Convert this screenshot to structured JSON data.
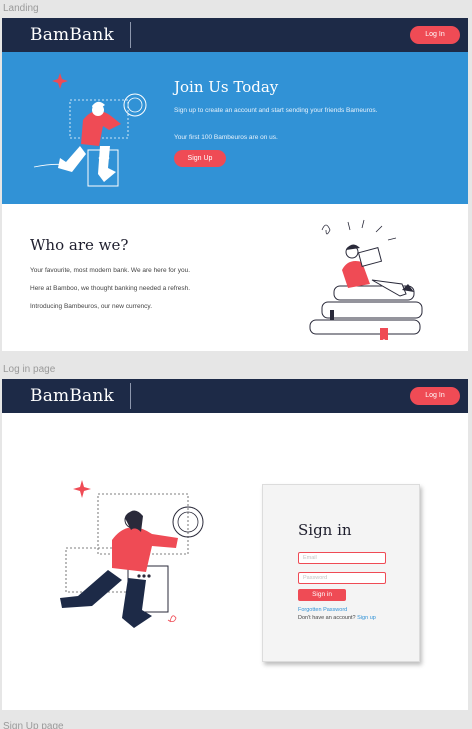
{
  "sections": {
    "landing_label": "Landing",
    "login_label": "Log in page",
    "signup_label": "Sign Up page"
  },
  "brand": "BamBank",
  "nav": {
    "login_label": "Log In"
  },
  "hero": {
    "title": "Join Us Today",
    "subtitle": "Sign up to create an account and start sending your friends Bameuros.",
    "note": "Your first 100 Bambeuros are on us.",
    "signup_label": "Sign Up"
  },
  "about": {
    "title": "Who are we?",
    "p1": "Your favourite, most modern bank. We are here for you.",
    "p2": "Here at Bamboo, we thought banking needed a refresh.",
    "p3": "Introducing Bambeuros, our new currency."
  },
  "signin": {
    "title": "Sign in",
    "email_placeholder": "Email",
    "password_placeholder": "Password",
    "button_label": "Sign in",
    "forgot_label": "Forgotten Password",
    "no_account_text": "Don't have an account?",
    "signup_link": "Sign up"
  },
  "colors": {
    "navy": "#1d2a47",
    "blue": "#3192d6",
    "coral": "#ef4b55"
  }
}
